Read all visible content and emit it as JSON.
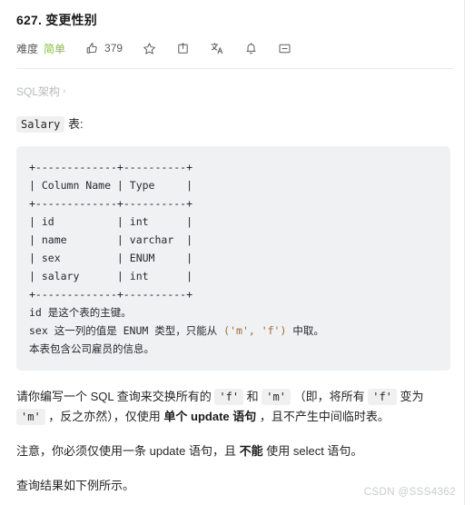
{
  "problem": {
    "title": "627. 变更性别",
    "difficulty_label": "难度",
    "difficulty_value": "简单",
    "vote_count": "379",
    "accent_green": "#84bf41"
  },
  "toolbar": {
    "icons": [
      {
        "name": "thumbs-up-icon",
        "label": "赞"
      },
      {
        "name": "star-icon",
        "label": "收藏"
      },
      {
        "name": "share-icon",
        "label": "分享"
      },
      {
        "name": "translate-icon",
        "label": "切换语言"
      },
      {
        "name": "bell-icon",
        "label": "订阅"
      },
      {
        "name": "comment-icon",
        "label": "讨论"
      }
    ]
  },
  "breadcrumb": {
    "label": "SQL架构",
    "chevron": "›"
  },
  "table_intro": {
    "code": "Salary",
    "suffix": " 表:"
  },
  "code_block": {
    "lines": [
      "+-------------+----------+",
      "| Column Name | Type     |",
      "+-------------+----------+",
      "| id          | int      |",
      "| name        | varchar  |",
      "| sex         | ENUM     |",
      "| salary      | int      |",
      "+-------------+----------+"
    ],
    "notes": {
      "line1": "id 是这个表的主键。",
      "line2_a": "sex 这一列的值是 ENUM 类型，只能从 ",
      "line2_str": "('m', 'f')",
      "line2_b": " 中取。",
      "line3": "本表包含公司雇员的信息。"
    },
    "background": "#f0f1f3",
    "string_color": "#9a6e3a"
  },
  "description": {
    "p1_part1": "请你编写一个 SQL 查询来交换所有的 ",
    "p1_code1": "'f'",
    "p1_part2": " 和 ",
    "p1_code2": "'m'",
    "p1_part3": " （即，将所有 ",
    "p1_code3": "'f'",
    "p1_part4": " 变为 ",
    "p1_code4": "'m'",
    "p1_part5": " ，反之亦然），仅使用 ",
    "p1_bold": "单个 update 语句",
    "p1_part6": " ，且不产生中间临时表。",
    "p2_part1": "注意，你必须仅使用一条 update 语句，且 ",
    "p2_bold": "不能",
    "p2_part2": " 使用 select 语句。",
    "p3": "查询结果如下例所示。"
  },
  "watermark": {
    "text": "CSDN @SSS4362"
  }
}
